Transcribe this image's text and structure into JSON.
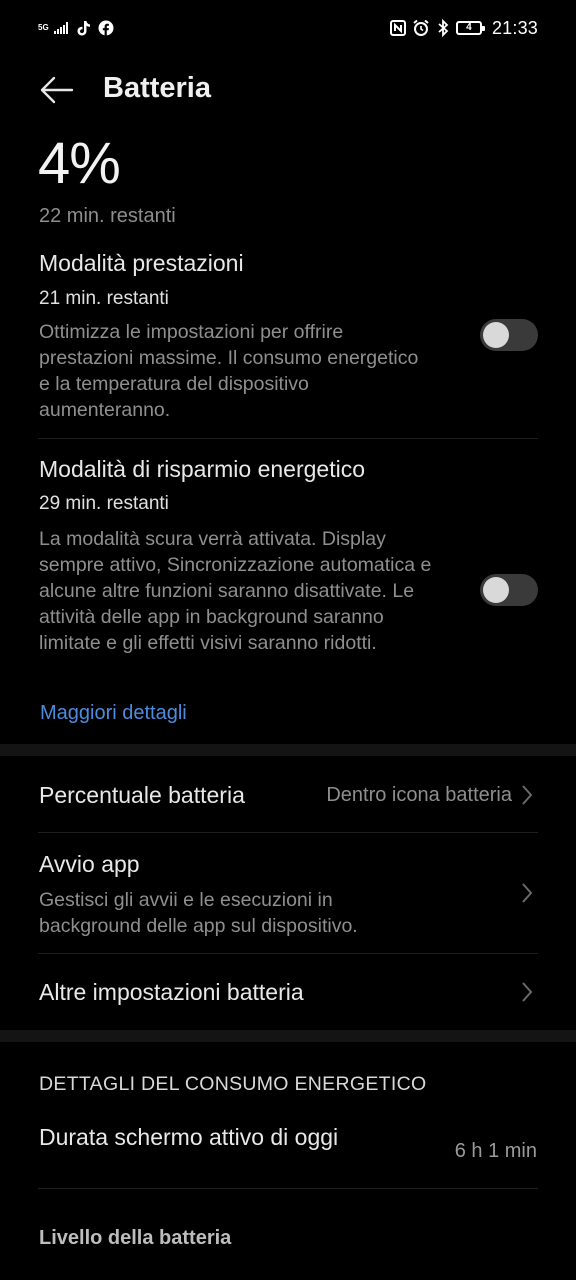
{
  "status_bar": {
    "network": "5G",
    "time": "21:33",
    "battery_level": "4"
  },
  "header": {
    "title": "Batteria"
  },
  "battery": {
    "percent": "4%",
    "remaining": "22 min. restanti"
  },
  "performance_mode": {
    "title": "Modalità prestazioni",
    "remaining": "21 min. restanti",
    "description": "Ottimizza le impostazioni per offrire prestazioni massime. Il consumo energetico e la temperatura del dispositivo aumenteranno.",
    "enabled": false
  },
  "power_saving_mode": {
    "title": "Modalità di risparmio energetico",
    "remaining": "29 min. restanti",
    "description": "La modalità scura verrà attivata. Display sempre attivo, Sincronizzazione automatica e alcune altre funzioni saranno disattivate. Le attività delle app in background saranno limitate e gli effetti visivi saranno ridotti.",
    "enabled": false
  },
  "more_details_link": "Maggiori dettagli",
  "settings": {
    "battery_percentage": {
      "label": "Percentuale batteria",
      "value": "Dentro icona batteria"
    },
    "app_launch": {
      "label": "Avvio app",
      "description": "Gestisci gli avvii e le esecuzioni in background delle app sul dispositivo."
    },
    "more_battery_settings": {
      "label": "Altre impostazioni batteria"
    }
  },
  "consumption": {
    "section_title": "DETTAGLI DEL CONSUMO ENERGETICO",
    "screen_on_label": "Durata schermo attivo di oggi",
    "screen_on_value": "6 h 1 min",
    "battery_level_label": "Livello della batteria"
  },
  "colors": {
    "background": "#000000",
    "link": "#4d8cdc",
    "toggle_off_track": "#3a3a3a",
    "toggle_off_knob": "#d9d9d9"
  },
  "icons": {
    "back": "arrow-left-icon",
    "chevron": "chevron-right-icon"
  }
}
